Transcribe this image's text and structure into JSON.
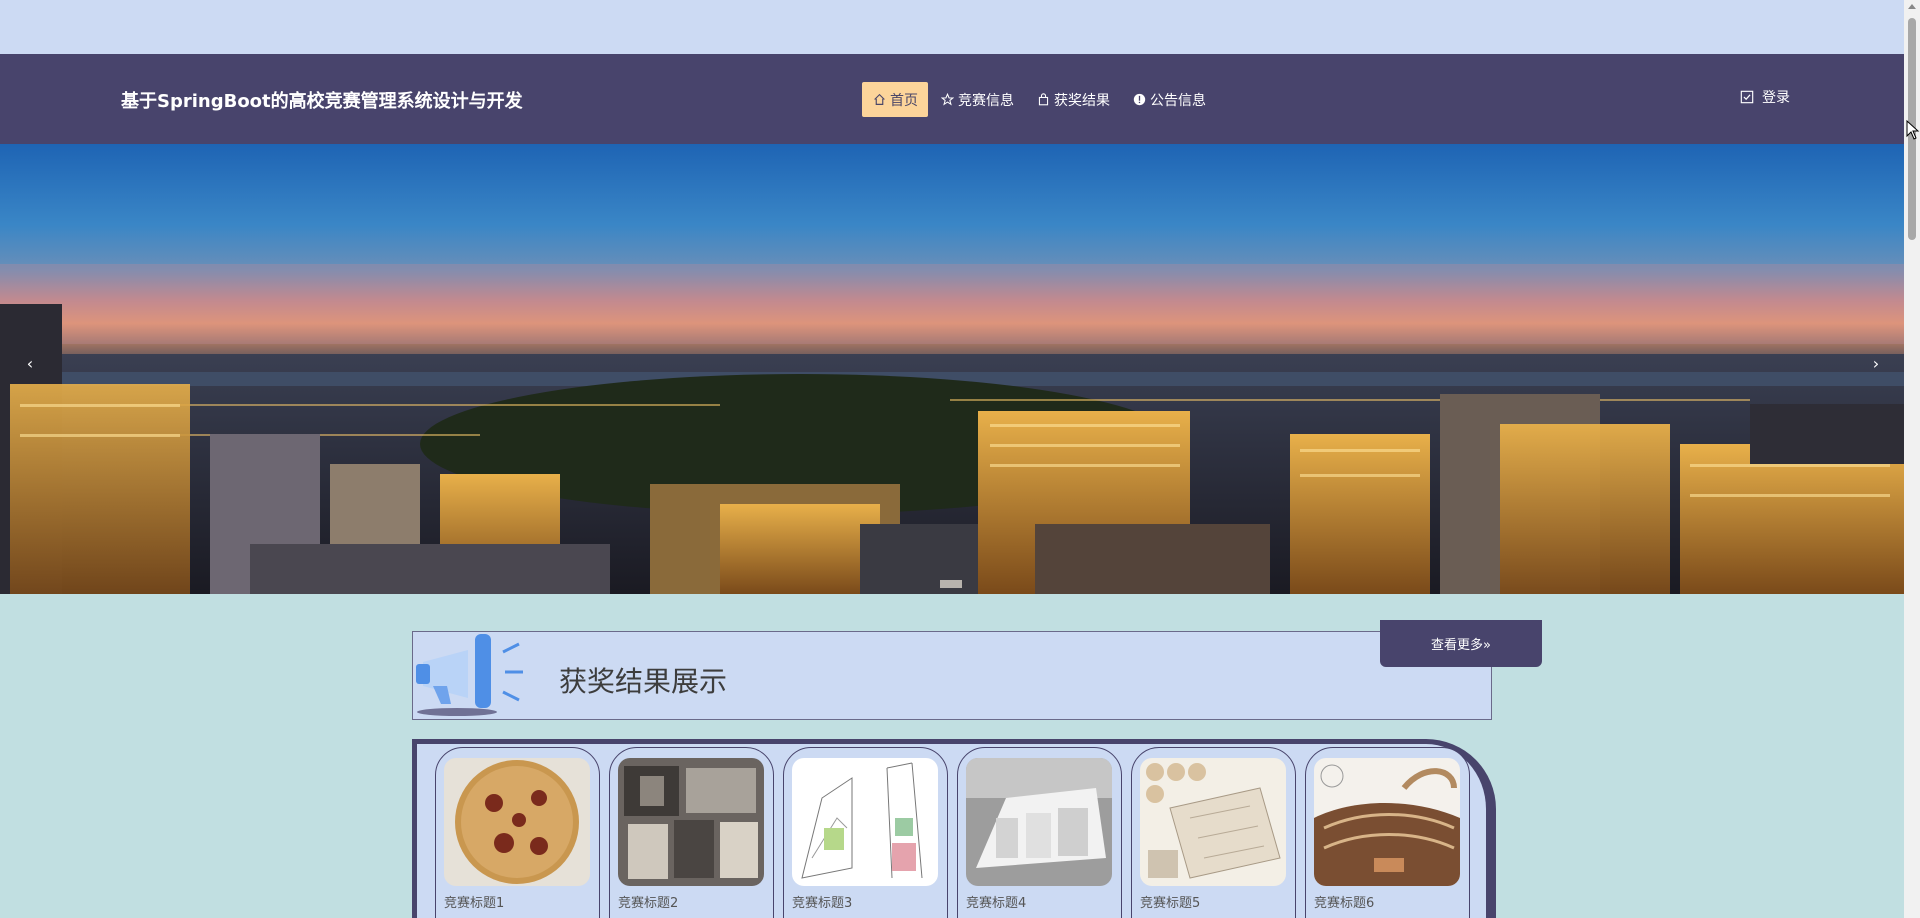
{
  "header": {
    "site_title": "基于SpringBoot的高校竞赛管理系统设计与开发",
    "nav": [
      {
        "label": "首页",
        "icon": "home-icon",
        "active": true
      },
      {
        "label": "竞赛信息",
        "icon": "star-icon",
        "active": false
      },
      {
        "label": "获奖结果",
        "icon": "bag-icon",
        "active": false
      },
      {
        "label": "公告信息",
        "icon": "info-icon",
        "active": false
      }
    ],
    "login_label": "登录"
  },
  "carousel": {
    "prev_arrow": "‹",
    "next_arrow": "›"
  },
  "awards_section": {
    "title": "获奖结果展示",
    "more_label": "查看更多»"
  },
  "cards": [
    {
      "label": "竞赛标题1"
    },
    {
      "label": "竞赛标题2"
    },
    {
      "label": "竞赛标题3"
    },
    {
      "label": "竞赛标题4"
    },
    {
      "label": "竞赛标题5"
    },
    {
      "label": "竞赛标题6"
    }
  ],
  "colors": {
    "nav_bg": "#48446c",
    "active_nav_bg": "#fcd49a",
    "page_bg": "#c1dfe1",
    "panel_bg": "#ccdaf3"
  }
}
